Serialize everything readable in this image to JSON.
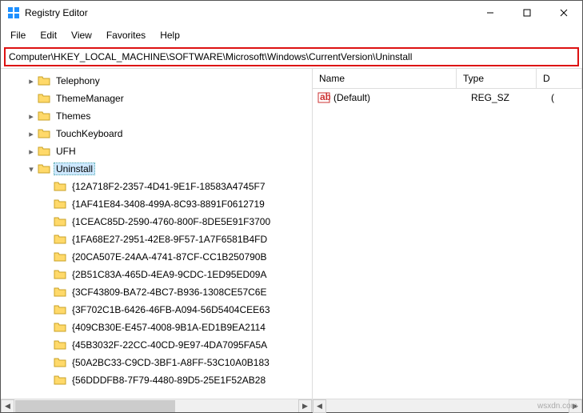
{
  "title": "Registry Editor",
  "menu": [
    "File",
    "Edit",
    "View",
    "Favorites",
    "Help"
  ],
  "address": "Computer\\HKEY_LOCAL_MACHINE\\SOFTWARE\\Microsoft\\Windows\\CurrentVersion\\Uninstall",
  "tree": [
    {
      "indent": 30,
      "exp": ">",
      "label": "Telephony",
      "sel": false
    },
    {
      "indent": 30,
      "exp": "",
      "label": "ThemeManager",
      "sel": false
    },
    {
      "indent": 30,
      "exp": ">",
      "label": "Themes",
      "sel": false
    },
    {
      "indent": 30,
      "exp": ">",
      "label": "TouchKeyboard",
      "sel": false
    },
    {
      "indent": 30,
      "exp": ">",
      "label": "UFH",
      "sel": false
    },
    {
      "indent": 30,
      "exp": "v",
      "label": "Uninstall",
      "sel": true
    },
    {
      "indent": 50,
      "exp": "",
      "label": "{12A718F2-2357-4D41-9E1F-18583A4745F7",
      "sel": false
    },
    {
      "indent": 50,
      "exp": "",
      "label": "{1AF41E84-3408-499A-8C93-8891F0612719",
      "sel": false
    },
    {
      "indent": 50,
      "exp": "",
      "label": "{1CEAC85D-2590-4760-800F-8DE5E91F3700",
      "sel": false
    },
    {
      "indent": 50,
      "exp": "",
      "label": "{1FA68E27-2951-42E8-9F57-1A7F6581B4FD",
      "sel": false
    },
    {
      "indent": 50,
      "exp": "",
      "label": "{20CA507E-24AA-4741-87CF-CC1B250790B",
      "sel": false
    },
    {
      "indent": 50,
      "exp": "",
      "label": "{2B51C83A-465D-4EA9-9CDC-1ED95ED09A",
      "sel": false
    },
    {
      "indent": 50,
      "exp": "",
      "label": "{3CF43809-BA72-4BC7-B936-1308CE57C6E",
      "sel": false
    },
    {
      "indent": 50,
      "exp": "",
      "label": "{3F702C1B-6426-46FB-A094-56D5404CEE63",
      "sel": false
    },
    {
      "indent": 50,
      "exp": "",
      "label": "{409CB30E-E457-4008-9B1A-ED1B9EA2114",
      "sel": false
    },
    {
      "indent": 50,
      "exp": "",
      "label": "{45B3032F-22CC-40CD-9E97-4DA7095FA5A",
      "sel": false
    },
    {
      "indent": 50,
      "exp": "",
      "label": "{50A2BC33-C9CD-3BF1-A8FF-53C10A0B183",
      "sel": false
    },
    {
      "indent": 50,
      "exp": "",
      "label": "{56DDDFB8-7F79-4480-89D5-25E1F52AB28",
      "sel": false
    }
  ],
  "left_thumb_w": 200,
  "list": {
    "headers": {
      "name": "Name",
      "type": "Type",
      "data": "D"
    },
    "rows": [
      {
        "name": "(Default)",
        "type": "REG_SZ",
        "data": "("
      }
    ]
  },
  "watermark": "wsxdn.com"
}
